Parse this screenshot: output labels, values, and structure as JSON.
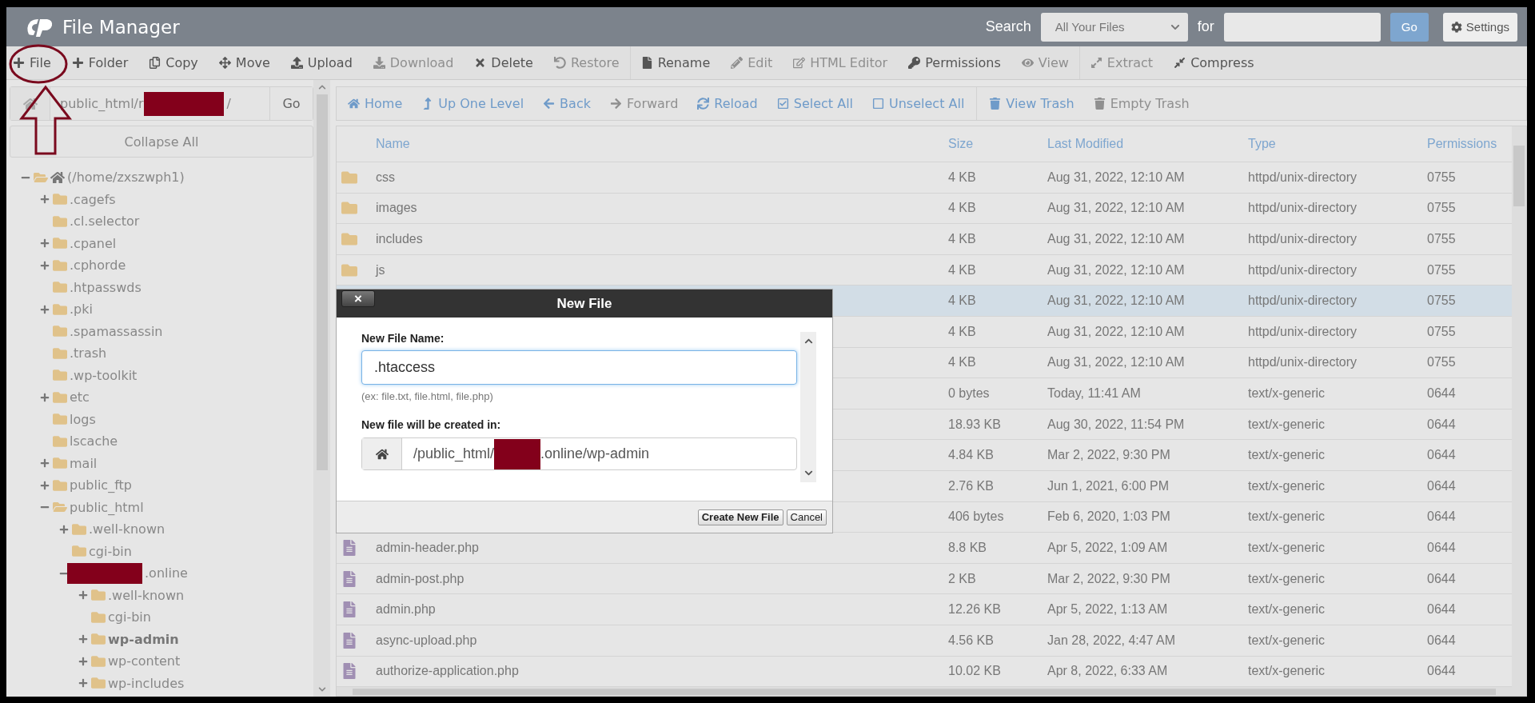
{
  "header": {
    "title": "File Manager",
    "search_label": "Search",
    "search_scope": "All Your Files",
    "for_label": "for",
    "go": "Go",
    "settings": "Settings"
  },
  "toolbar": [
    [
      {
        "label": "File",
        "disabled": false
      },
      {
        "label": "Folder",
        "disabled": false
      },
      {
        "label": "Copy",
        "disabled": false
      },
      {
        "label": "Move",
        "disabled": false
      },
      {
        "label": "Upload",
        "disabled": false
      },
      {
        "label": "Download",
        "disabled": true
      },
      {
        "label": "Delete",
        "disabled": false
      },
      {
        "label": "Restore",
        "disabled": true
      }
    ],
    [
      {
        "label": "Rename",
        "disabled": false
      },
      {
        "label": "Edit",
        "disabled": true
      },
      {
        "label": "HTML Editor",
        "disabled": true
      },
      {
        "label": "Permissions",
        "disabled": false
      },
      {
        "label": "View",
        "disabled": true
      }
    ],
    [
      {
        "label": "Extract",
        "disabled": true
      },
      {
        "label": "Compress",
        "disabled": false
      }
    ]
  ],
  "sidebar": {
    "path_start": "public_html/r",
    "path_end": "/",
    "go": "Go",
    "collapse": "Collapse All",
    "tree": [
      {
        "label": "(/home/zxszwph1)",
        "kind": "expanded",
        "root": true,
        "selected": false,
        "children": [
          {
            "label": ".cagefs",
            "kind": "collapsed",
            "selected": false
          },
          {
            "label": ".cl.selector",
            "kind": "leaf",
            "selected": false
          },
          {
            "label": ".cpanel",
            "kind": "collapsed",
            "selected": false
          },
          {
            "label": ".cphorde",
            "kind": "collapsed",
            "selected": false
          },
          {
            "label": ".htpasswds",
            "kind": "leaf",
            "selected": false
          },
          {
            "label": ".pki",
            "kind": "collapsed",
            "selected": false
          },
          {
            "label": ".spamassassin",
            "kind": "leaf",
            "selected": false
          },
          {
            "label": ".trash",
            "kind": "leaf",
            "selected": false
          },
          {
            "label": ".wp-toolkit",
            "kind": "leaf",
            "selected": false
          },
          {
            "label": "etc",
            "kind": "collapsed",
            "selected": false
          },
          {
            "label": "logs",
            "kind": "leaf",
            "selected": false
          },
          {
            "label": "lscache",
            "kind": "leaf",
            "selected": false
          },
          {
            "label": "mail",
            "kind": "collapsed",
            "selected": false
          },
          {
            "label": "public_ftp",
            "kind": "collapsed",
            "selected": false
          },
          {
            "label": "public_html",
            "kind": "expanded",
            "selected": false,
            "children": [
              {
                "label": ".well-known",
                "kind": "collapsed",
                "selected": false
              },
              {
                "label": "cgi-bin",
                "kind": "leaf",
                "selected": false
              },
              {
                "label": ".online",
                "kind": "expanded",
                "redacted": true,
                "selected": false,
                "children": [
                  {
                    "label": ".well-known",
                    "kind": "collapsed",
                    "selected": false
                  },
                  {
                    "label": "cgi-bin",
                    "kind": "leaf",
                    "selected": false
                  },
                  {
                    "label": "wp-admin",
                    "kind": "collapsed",
                    "selected": true
                  },
                  {
                    "label": "wp-content",
                    "kind": "collapsed",
                    "selected": false
                  },
                  {
                    "label": "wp-includes",
                    "kind": "collapsed",
                    "selected": false
                  }
                ]
              }
            ]
          }
        ]
      }
    ]
  },
  "navbar": [
    [
      {
        "label": "Home",
        "disabled": false
      },
      {
        "label": "Up One Level",
        "disabled": false
      },
      {
        "label": "Back",
        "disabled": false
      },
      {
        "label": "Forward",
        "disabled": true
      },
      {
        "label": "Reload",
        "disabled": false
      },
      {
        "label": "Select All",
        "disabled": false
      },
      {
        "label": "Unselect All",
        "disabled": false
      }
    ],
    [
      {
        "label": "View Trash",
        "disabled": false
      },
      {
        "label": "Empty Trash",
        "disabled": true
      }
    ]
  ],
  "table": {
    "columns": [
      "Name",
      "Size",
      "Last Modified",
      "Type",
      "Permissions"
    ],
    "rows": [
      {
        "kind": "folder",
        "name": "css",
        "size": "4 KB",
        "modified": "Aug 31, 2022, 12:10 AM",
        "type": "httpd/unix-directory",
        "permissions": "0755",
        "selected": false
      },
      {
        "kind": "folder",
        "name": "images",
        "size": "4 KB",
        "modified": "Aug 31, 2022, 12:10 AM",
        "type": "httpd/unix-directory",
        "permissions": "0755",
        "selected": false
      },
      {
        "kind": "folder",
        "name": "includes",
        "size": "4 KB",
        "modified": "Aug 31, 2022, 12:10 AM",
        "type": "httpd/unix-directory",
        "permissions": "0755",
        "selected": false
      },
      {
        "kind": "folder",
        "name": "js",
        "size": "4 KB",
        "modified": "Aug 31, 2022, 12:10 AM",
        "type": "httpd/unix-directory",
        "permissions": "0755",
        "selected": false
      },
      {
        "kind": "hidden",
        "size": "4 KB",
        "modified": "Aug 31, 2022, 12:10 AM",
        "type": "httpd/unix-directory",
        "permissions": "0755",
        "selected": true
      },
      {
        "kind": "hidden",
        "size": "4 KB",
        "modified": "Aug 31, 2022, 12:10 AM",
        "type": "httpd/unix-directory",
        "permissions": "0755",
        "selected": false
      },
      {
        "kind": "hidden",
        "size": "4 KB",
        "modified": "Aug 31, 2022, 12:10 AM",
        "type": "httpd/unix-directory",
        "permissions": "0755",
        "selected": false
      },
      {
        "kind": "hidden",
        "size": "0 bytes",
        "modified": "Today, 11:41 AM",
        "type": "text/x-generic",
        "permissions": "0644",
        "selected": false
      },
      {
        "kind": "hidden",
        "size": "18.93 KB",
        "modified": "Aug 30, 2022, 11:54 PM",
        "type": "text/x-generic",
        "permissions": "0644",
        "selected": false
      },
      {
        "kind": "hidden",
        "size": "4.84 KB",
        "modified": "Mar 2, 2022, 9:30 PM",
        "type": "text/x-generic",
        "permissions": "0644",
        "selected": false
      },
      {
        "kind": "hidden",
        "size": "2.76 KB",
        "modified": "Jun 1, 2021, 6:00 PM",
        "type": "text/x-generic",
        "permissions": "0644",
        "selected": false
      },
      {
        "kind": "hidden",
        "size": "406 bytes",
        "modified": "Feb 6, 2020, 1:03 PM",
        "type": "text/x-generic",
        "permissions": "0644",
        "selected": false
      },
      {
        "kind": "file",
        "name": "admin-header.php",
        "size": "8.8 KB",
        "modified": "Apr 5, 2022, 1:09 AM",
        "type": "text/x-generic",
        "permissions": "0644",
        "selected": false
      },
      {
        "kind": "file",
        "name": "admin-post.php",
        "size": "2 KB",
        "modified": "Mar 2, 2022, 9:30 PM",
        "type": "text/x-generic",
        "permissions": "0644",
        "selected": false
      },
      {
        "kind": "file",
        "name": "admin.php",
        "size": "12.26 KB",
        "modified": "Apr 5, 2022, 1:13 AM",
        "type": "text/x-generic",
        "permissions": "0644",
        "selected": false
      },
      {
        "kind": "file",
        "name": "async-upload.php",
        "size": "4.56 KB",
        "modified": "Jan 28, 2022, 4:47 AM",
        "type": "text/x-generic",
        "permissions": "0644",
        "selected": false
      },
      {
        "kind": "file",
        "name": "authorize-application.php",
        "size": "10.02 KB",
        "modified": "Apr 8, 2022, 6:33 AM",
        "type": "text/x-generic",
        "permissions": "0644",
        "selected": false
      }
    ]
  },
  "dialog": {
    "title": "New File",
    "close": "×",
    "name_label": "New File Name:",
    "name_value": ".htaccess",
    "hint": "(ex: file.txt, file.html, file.php)",
    "location_label": "New file will be created in:",
    "location_start": "/public_html/",
    "location_end": ".online/wp-admin",
    "buttons": [
      "Create New File",
      "Cancel"
    ]
  }
}
